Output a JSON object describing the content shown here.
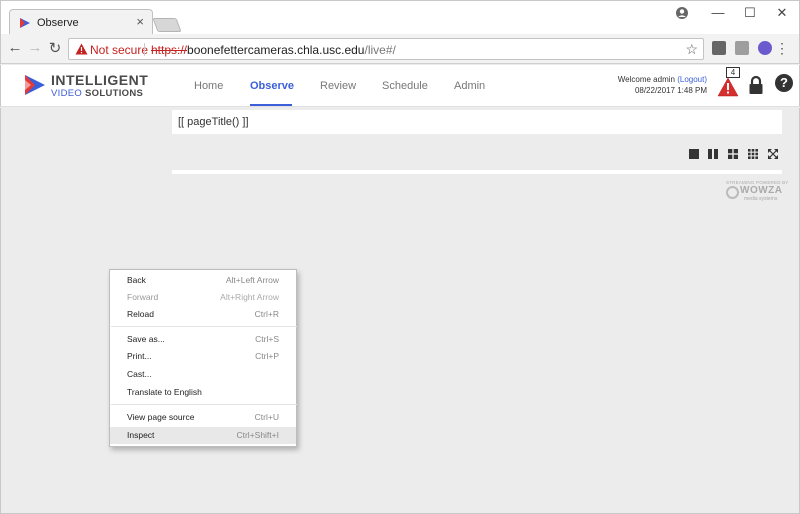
{
  "browser": {
    "tab_title": "Observe",
    "tab_close": "×",
    "window_controls": {
      "minimize": "—",
      "maximize": "☐",
      "close": "✕"
    },
    "security_label": "Not secure",
    "url_scheme": "https://",
    "url_host": "boonefettercameras.chla.usc.edu",
    "url_path": "/live#/",
    "menu_icon": "⋮"
  },
  "app": {
    "logo": {
      "line1": "INTELLIGENT",
      "line2_a": "VIDEO",
      "line2_b": "SOLUTIONS"
    },
    "nav": [
      {
        "label": "Home",
        "active": false
      },
      {
        "label": "Observe",
        "active": true
      },
      {
        "label": "Review",
        "active": false
      },
      {
        "label": "Schedule",
        "active": false
      },
      {
        "label": "Admin",
        "active": false
      }
    ],
    "welcome_text": "Welcome admin",
    "logout_label": "(Logout)",
    "datetime": "08/22/2017 1:48 PM",
    "alert_count": "4",
    "help_label": "?",
    "accent_color": "#3a5fd8",
    "alert_color": "#d32f2f"
  },
  "content": {
    "page_title": "[[ pageTitle() ]]",
    "wowza": {
      "powered_by": "STREAMING POWERED BY",
      "brand": "WOWZA",
      "sub": "media systems"
    }
  },
  "context_menu": {
    "groups": [
      [
        {
          "label": "Back",
          "shortcut": "Alt+Left Arrow",
          "disabled": false
        },
        {
          "label": "Forward",
          "shortcut": "Alt+Right Arrow",
          "disabled": true
        },
        {
          "label": "Reload",
          "shortcut": "Ctrl+R",
          "disabled": false
        }
      ],
      [
        {
          "label": "Save as...",
          "shortcut": "Ctrl+S",
          "disabled": false
        },
        {
          "label": "Print...",
          "shortcut": "Ctrl+P",
          "disabled": false
        },
        {
          "label": "Cast...",
          "shortcut": "",
          "disabled": false
        },
        {
          "label": "Translate to English",
          "shortcut": "",
          "disabled": false
        }
      ],
      [
        {
          "label": "View page source",
          "shortcut": "Ctrl+U",
          "disabled": false
        },
        {
          "label": "Inspect",
          "shortcut": "Ctrl+Shift+I",
          "disabled": false,
          "highlighted": true
        }
      ]
    ]
  }
}
